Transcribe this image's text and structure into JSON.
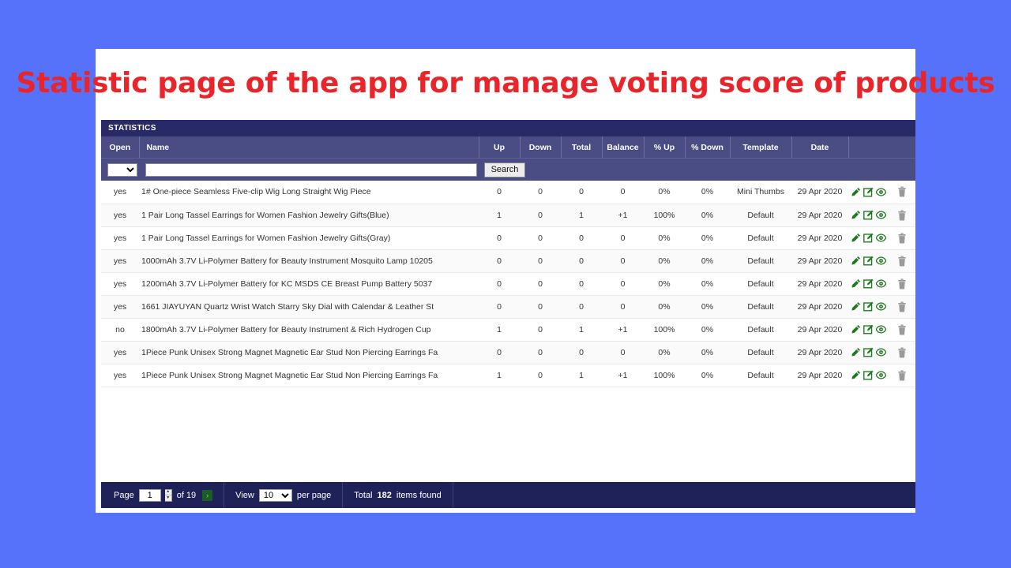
{
  "slide": {
    "title": "Statistic page of the app for manage voting score of products",
    "title_color": "#e8252a",
    "background_color": "#5671fa"
  },
  "app": {
    "window_title": "STATISTICS",
    "header_color": "#4a4c84",
    "titlebar_color": "#272a66",
    "footer_color": "#1e2258"
  },
  "table": {
    "columns": [
      {
        "key": "open",
        "label": "Open"
      },
      {
        "key": "name",
        "label": "Name"
      },
      {
        "key": "up",
        "label": "Up"
      },
      {
        "key": "down",
        "label": "Down"
      },
      {
        "key": "total",
        "label": "Total"
      },
      {
        "key": "balance",
        "label": "Balance"
      },
      {
        "key": "pct_up",
        "label": "% Up"
      },
      {
        "key": "pct_down",
        "label": "% Down"
      },
      {
        "key": "template",
        "label": "Template"
      },
      {
        "key": "date",
        "label": "Date"
      },
      {
        "key": "actions",
        "label": ""
      }
    ],
    "rows": [
      {
        "open": "yes",
        "name": "1# One-piece Seamless Five-clip Wig Long Straight Wig Piece",
        "up": "0",
        "down": "0",
        "total": "0",
        "balance": "0",
        "pct_up": "0%",
        "pct_down": "0%",
        "template": "Mini Thumbs",
        "date": "29 Apr 2020"
      },
      {
        "open": "yes",
        "name": "1 Pair Long Tassel Earrings for Women Fashion Jewelry Gifts(Blue)",
        "up": "1",
        "down": "0",
        "total": "1",
        "balance": "+1",
        "pct_up": "100%",
        "pct_down": "0%",
        "template": "Default",
        "date": "29 Apr 2020"
      },
      {
        "open": "yes",
        "name": "1 Pair Long Tassel Earrings for Women Fashion Jewelry Gifts(Gray)",
        "up": "0",
        "down": "0",
        "total": "0",
        "balance": "0",
        "pct_up": "0%",
        "pct_down": "0%",
        "template": "Default",
        "date": "29 Apr 2020"
      },
      {
        "open": "yes",
        "name": "1000mAh  3.7V Li-Polymer Battery for Beauty Instrument  Mosquito Lamp 10205",
        "up": "0",
        "down": "0",
        "total": "0",
        "balance": "0",
        "pct_up": "0%",
        "pct_down": "0%",
        "template": "Default",
        "date": "29 Apr 2020"
      },
      {
        "open": "yes",
        "name": "1200mAh 3.7V  Li-Polymer Battery for KC MSDS CE Breast Pump Battery 5037",
        "up": "0",
        "down": "0",
        "total": "0",
        "balance": "0",
        "pct_up": "0%",
        "pct_down": "0%",
        "template": "Default",
        "date": "29 Apr 2020"
      },
      {
        "open": "yes",
        "name": "1661 JIAYUYAN  Quartz Wrist Watch Starry Sky Dial with Calendar & Leather St",
        "up": "0",
        "down": "0",
        "total": "0",
        "balance": "0",
        "pct_up": "0%",
        "pct_down": "0%",
        "template": "Default",
        "date": "29 Apr 2020"
      },
      {
        "open": "no",
        "name": "1800mAh  3.7V Li-Polymer Battery for Beauty Instrument  & Rich Hydrogen Cup",
        "up": "1",
        "down": "0",
        "total": "1",
        "balance": "+1",
        "pct_up": "100%",
        "pct_down": "0%",
        "template": "Default",
        "date": "29 Apr 2020"
      },
      {
        "open": "yes",
        "name": "1Piece Punk Unisex Strong Magnet Magnetic Ear Stud Non Piercing Earrings Fa",
        "up": "0",
        "down": "0",
        "total": "0",
        "balance": "0",
        "pct_up": "0%",
        "pct_down": "0%",
        "template": "Default",
        "date": "29 Apr 2020"
      },
      {
        "open": "yes",
        "name": "1Piece Punk Unisex Strong Magnet Magnetic Ear Stud Non Piercing Earrings Fa",
        "up": "1",
        "down": "0",
        "total": "1",
        "balance": "+1",
        "pct_up": "100%",
        "pct_down": "0%",
        "template": "Default",
        "date": "29 Apr 2020"
      }
    ],
    "row_actions": [
      {
        "name": "edit-pencil-icon",
        "title": "Edit"
      },
      {
        "name": "edit-square-icon",
        "title": "Edit details"
      },
      {
        "name": "preview-eye-icon",
        "title": "Preview"
      },
      {
        "name": "delete-trash-icon",
        "title": "Delete"
      }
    ]
  },
  "search": {
    "select_value": "",
    "input_value": "",
    "input_placeholder": "",
    "button_label": "Search"
  },
  "footer": {
    "page_label": "Page",
    "page_value": "1",
    "of_label": "of 19",
    "next_arrow": "›",
    "view_label": "View",
    "per_page_value": "10",
    "per_page_label": "per page",
    "total_prefix": "Total",
    "total_count": "182",
    "total_suffix": "items found"
  }
}
